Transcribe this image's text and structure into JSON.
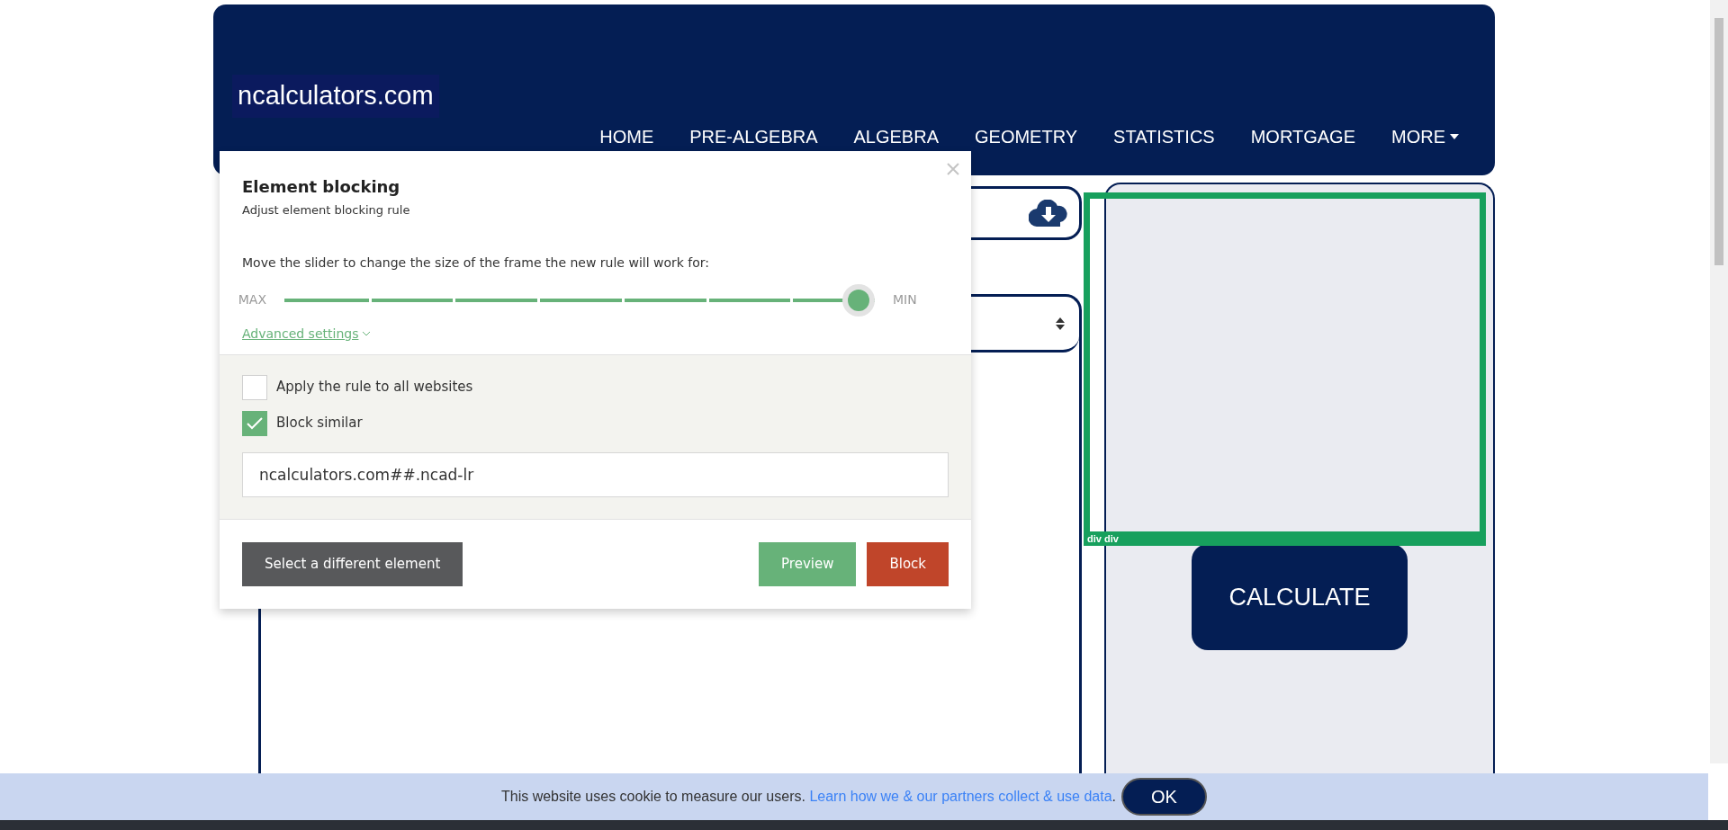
{
  "site": {
    "logo": "ncalculators.com",
    "nav": [
      {
        "label": "HOME",
        "kind": "link"
      },
      {
        "label": "PRE-ALGEBRA",
        "kind": "link"
      },
      {
        "label": "ALGEBRA",
        "kind": "link"
      },
      {
        "label": "GEOMETRY",
        "kind": "link"
      },
      {
        "label": "STATISTICS",
        "kind": "link"
      },
      {
        "label": "MORTGAGE",
        "kind": "link"
      },
      {
        "label": "MORE",
        "kind": "dropdown"
      }
    ],
    "calculate_button": "CALCULATE",
    "highlight_label": "div div"
  },
  "dialog": {
    "title": "Element blocking",
    "subtitle": "Adjust element blocking rule",
    "instruction": "Move the slider to change the size of the frame the new rule will work for:",
    "slider": {
      "min_label": "MAX",
      "max_label": "MIN",
      "level": 1
    },
    "advanced_link": "Advanced settings",
    "advanced_expanded": true,
    "options": [
      {
        "label": "Apply the rule to all websites",
        "checked": false
      },
      {
        "label": "Block similar",
        "checked": true
      }
    ],
    "rule_value": "ncalculators.com##.ncad-lr",
    "buttons": [
      {
        "label": "Select a different element",
        "kind": "secondary"
      },
      {
        "label": "Preview",
        "kind": "preview"
      },
      {
        "label": "Block",
        "kind": "danger"
      }
    ]
  },
  "cookie_bar": {
    "text": "This website uses cookie to measure our users.",
    "link": "Learn how we & our partners collect & use data",
    "after_link": ".",
    "button": "OK"
  }
}
